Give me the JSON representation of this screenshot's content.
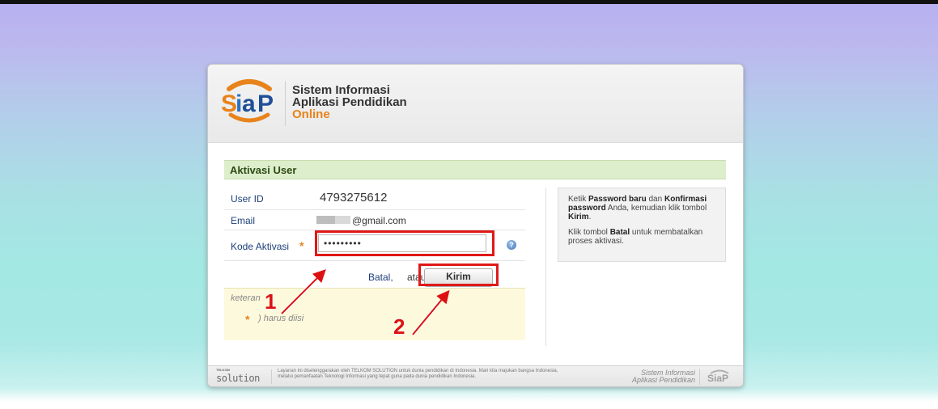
{
  "header": {
    "brand_line1": "Sistem Informasi",
    "brand_line2": "Aplikasi Pendidikan",
    "brand_line3": "Online",
    "logo_text": "SiaP"
  },
  "section": {
    "title": "Aktivasi User"
  },
  "form": {
    "user_id_label": "User ID",
    "user_id_value": "4793275612",
    "email_label": "Email",
    "email_value": "@gmail.com",
    "kode_label": "Kode Aktivasi",
    "kode_value": "•••••••••",
    "required_mark": "*",
    "batal_label": "Batal,",
    "atau_label": "atau",
    "kirim_label": "Kirim"
  },
  "note": {
    "title": "keteran",
    "line": ") harus diisi"
  },
  "info": {
    "p1_a": "Ketik ",
    "p1_b": "Password baru",
    "p1_c": " dan ",
    "p1_d": "Konfirmasi password",
    "p1_e": " Anda, kemudian klik tombol ",
    "p1_f": "Kirim",
    "p1_g": ".",
    "p2_a": "Klik tombol ",
    "p2_b": "Batal",
    "p2_c": " untuk membatalkan proses aktivasi."
  },
  "footer": {
    "logo_small": "TELKOM",
    "logo_word": "solution",
    "text": "Layanan ini diselenggarakan oleh TELKOM SOLUTION untuk dunia pendidikan di Indonesia. Mari kita majukan bangsa Indonesia, melalui pemanfaatan Teknologi Informasi yang tepat guna pada dunia pendidikan Indonesia.",
    "right_line1": "Sistem Informasi",
    "right_line2": "Aplikasi Pendidikan",
    "logo2_text": "SiaP"
  },
  "annotations": {
    "step1": "1",
    "step2": "2"
  },
  "colors": {
    "accent": "#e8831c",
    "highlight": "#e01818",
    "link": "#1d3f78"
  }
}
